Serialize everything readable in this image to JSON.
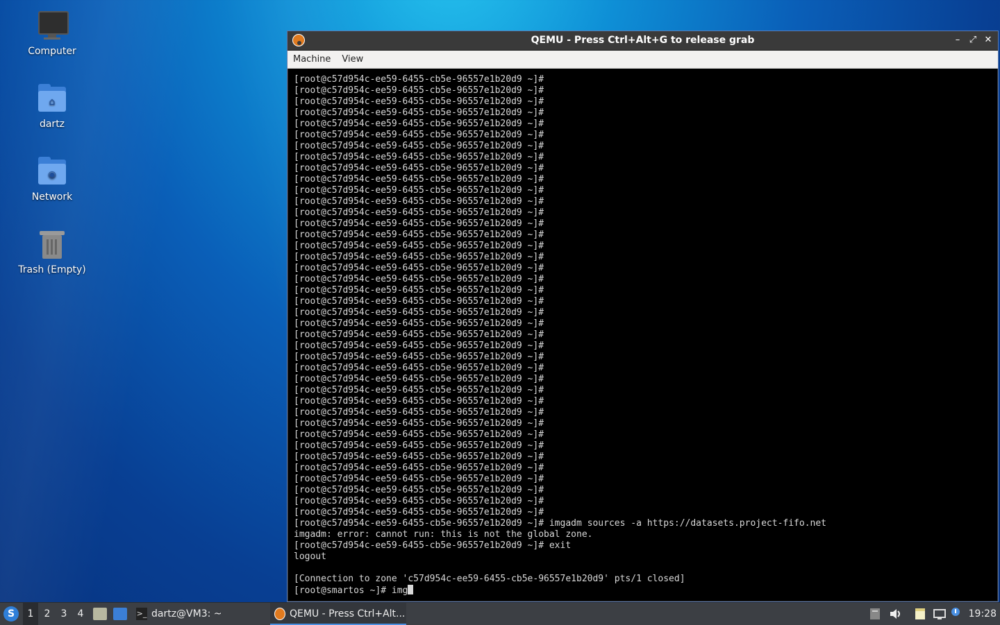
{
  "desktop": {
    "icons": [
      {
        "label": "Computer",
        "icon": "computer-icon"
      },
      {
        "label": "dartz",
        "icon": "home-folder-icon"
      },
      {
        "label": "Network",
        "icon": "network-folder-icon"
      },
      {
        "label": "Trash (Empty)",
        "icon": "trash-icon"
      }
    ]
  },
  "window": {
    "title": "QEMU - Press Ctrl+Alt+G to release grab",
    "menu": [
      "Machine",
      "View"
    ],
    "buttons": {
      "minimize": "–",
      "maximize": "⤢",
      "close": "✕"
    }
  },
  "console": {
    "prompt_line": "[root@c57d954c-ee59-6455-cb5e-96557e1b20d9 ~]#",
    "prompt_repeat_count": 40,
    "tail_lines": [
      "[root@c57d954c-ee59-6455-cb5e-96557e1b20d9 ~]# imgadm sources -a https://datasets.project-fifo.net",
      "imgadm: error: cannot run: this is not the global zone.",
      "[root@c57d954c-ee59-6455-cb5e-96557e1b20d9 ~]# exit",
      "logout",
      "",
      "[Connection to zone 'c57d954c-ee59-6455-cb5e-96557e1b20d9' pts/1 closed]"
    ],
    "current_line": "[root@smartos ~]# img"
  },
  "taskbar": {
    "workspaces": [
      "1",
      "2",
      "3",
      "4"
    ],
    "active_workspace": "1",
    "tasks": [
      {
        "label": "dartz@VM3: ~",
        "icon": "terminal-icon"
      },
      {
        "label": "QEMU - Press Ctrl+Alt...",
        "icon": "qemu-icon"
      }
    ],
    "clock": "19:28"
  }
}
